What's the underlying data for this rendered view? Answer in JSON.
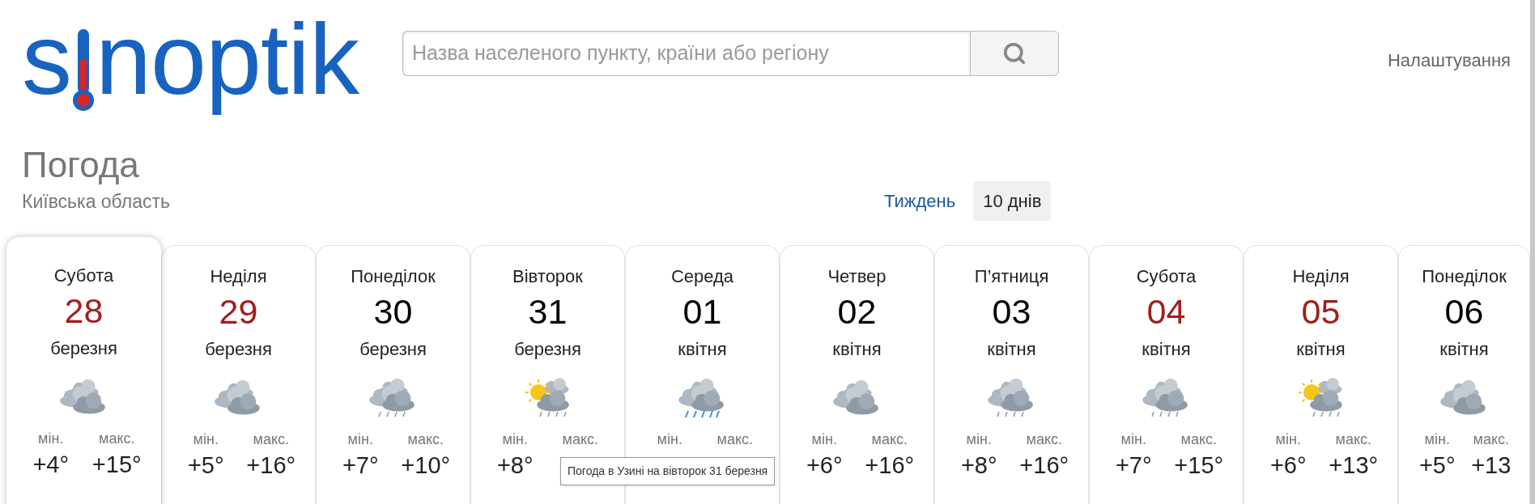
{
  "logo": {
    "before": "s",
    "after": "noptik"
  },
  "search": {
    "placeholder": "Назва населеного пункту, країни або регіону"
  },
  "settings": "Налаштування",
  "title": "Погода",
  "region": "Київська область",
  "tabs": [
    {
      "label": "Тиждень",
      "selected": false
    },
    {
      "label": "10 днів",
      "selected": true
    }
  ],
  "days": [
    {
      "day": "Субота",
      "date": "28",
      "month": "березня",
      "weekend": true,
      "selected": true,
      "kind": "overcast",
      "min_label": "мін.",
      "max_label": "макс.",
      "min": "+4°",
      "max": "+15°"
    },
    {
      "day": "Неділя",
      "date": "29",
      "month": "березня",
      "weekend": true,
      "selected": false,
      "kind": "overcast",
      "min_label": "мін.",
      "max_label": "макс.",
      "min": "+5°",
      "max": "+16°"
    },
    {
      "day": "Понеділок",
      "date": "30",
      "month": "березня",
      "weekend": false,
      "selected": false,
      "kind": "rain",
      "min_label": "мін.",
      "max_label": "макс.",
      "min": "+7°",
      "max": "+10°"
    },
    {
      "day": "Вівторок",
      "date": "31",
      "month": "березня",
      "weekend": false,
      "selected": false,
      "kind": "sun-rain",
      "min_label": "мін.",
      "max_label": "макс.",
      "min": "+8°"
    },
    {
      "day": "Середа",
      "date": "01",
      "month": "квітня",
      "weekend": false,
      "selected": false,
      "kind": "showers",
      "min_label": "мін.",
      "max_label": "макс."
    },
    {
      "day": "Четвер",
      "date": "02",
      "month": "квітня",
      "weekend": false,
      "selected": false,
      "kind": "overcast",
      "min_label": "мін.",
      "max_label": "макс.",
      "min": "+6°",
      "max": "+16°"
    },
    {
      "day": "П’ятниця",
      "date": "03",
      "month": "квітня",
      "weekend": false,
      "selected": false,
      "kind": "rain",
      "min_label": "мін.",
      "max_label": "макс.",
      "min": "+8°",
      "max": "+16°"
    },
    {
      "day": "Субота",
      "date": "04",
      "month": "квітня",
      "weekend": true,
      "selected": false,
      "kind": "rain",
      "min_label": "мін.",
      "max_label": "макс.",
      "min": "+7°",
      "max": "+15°"
    },
    {
      "day": "Неділя",
      "date": "05",
      "month": "квітня",
      "weekend": true,
      "selected": false,
      "kind": "sun-rain",
      "min_label": "мін.",
      "max_label": "макс.",
      "min": "+6°",
      "max": "+13°"
    },
    {
      "day": "Понеділок",
      "date": "06",
      "month": "квітня",
      "weekend": false,
      "selected": false,
      "kind": "overcast",
      "min_label": "мін.",
      "max_label": "макс.",
      "min": "+5°",
      "max": "+13"
    }
  ],
  "tooltip": "Погода в Узині на вівторок 31 березня"
}
